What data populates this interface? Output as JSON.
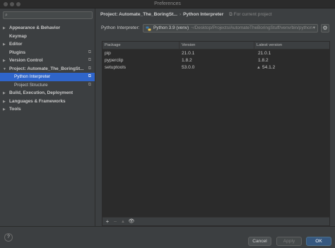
{
  "window": {
    "title": "Preferences"
  },
  "sidebar": {
    "search": {
      "placeholder": ""
    },
    "items": [
      {
        "label": "Appearance & Behavior",
        "arrow": "▶",
        "badge": ""
      },
      {
        "label": "Keymap",
        "arrow": "",
        "badge": ""
      },
      {
        "label": "Editor",
        "arrow": "▶",
        "badge": ""
      },
      {
        "label": "Plugins",
        "arrow": "",
        "badge": "⧉"
      },
      {
        "label": "Version Control",
        "arrow": "▶",
        "badge": "⧉"
      },
      {
        "label": "Project: Automate_The_BoringSt...",
        "arrow": "▼",
        "badge": "⧉"
      },
      {
        "label": "Python Interpreter",
        "arrow": "",
        "badge": "⧉"
      },
      {
        "label": "Project Structure",
        "arrow": "",
        "badge": "⧉"
      },
      {
        "label": "Build, Execution, Deployment",
        "arrow": "▶",
        "badge": ""
      },
      {
        "label": "Languages & Frameworks",
        "arrow": "▶",
        "badge": ""
      },
      {
        "label": "Tools",
        "arrow": "▶",
        "badge": ""
      }
    ]
  },
  "breadcrumb": {
    "project": "Project: Automate_The_BoringSt...",
    "separator": "›",
    "page": "Python Interpreter",
    "scope_icon": "⧉",
    "scope": "For current project"
  },
  "interpreter": {
    "label": "Python Interpreter:",
    "name": "Python 3.9 (venv)",
    "path": "~/Desktop/Projects/AutomateTheBoringStuff/venv/bin/python",
    "chevron": "▾",
    "gear": "⚙"
  },
  "packages": {
    "headers": [
      "Package",
      "Version",
      "Latest version"
    ],
    "rows": [
      {
        "package": "pip",
        "version": "21.0.1",
        "latest": "21.0.1",
        "upgrade": ""
      },
      {
        "package": "pyperclip",
        "version": "1.8.2",
        "latest": "1.8.2",
        "upgrade": ""
      },
      {
        "package": "setuptools",
        "version": "53.0.0",
        "latest": "54.1.2",
        "upgrade": "▲"
      }
    ],
    "toolbar": {
      "add": "+",
      "remove": "−",
      "upgrade": "▲",
      "show": "👁"
    }
  },
  "footer": {
    "help": "?",
    "cancel": "Cancel",
    "apply": "Apply",
    "ok": "OK"
  },
  "colors": {
    "selection": "#2f65ca",
    "primary_button": "#365880",
    "background": "#3c3f41"
  }
}
